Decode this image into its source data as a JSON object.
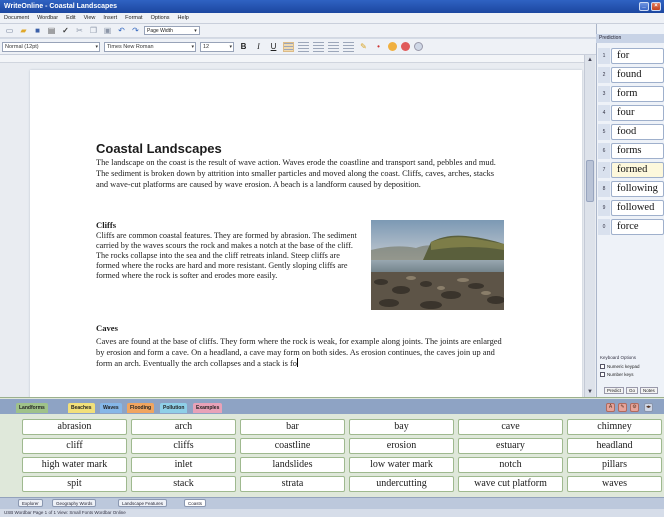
{
  "window": {
    "title": "WriteOnline - Coastal Landscapes"
  },
  "menu": [
    "Document",
    "Wordbar",
    "Edit",
    "View",
    "Insert",
    "Format",
    "Options",
    "Help"
  ],
  "toolbar": {
    "zoom": "Page Width",
    "style": "Normal (12pt)",
    "font": "Times New Roman",
    "size": "12",
    "bold": "B",
    "italic": "I",
    "underline": "U"
  },
  "document": {
    "title": "Coastal Landscapes",
    "intro": "The landscape on the coast is the result of wave action. Waves erode the coastline and transport sand, pebbles and mud. The sediment is broken down by attrition into smaller particles and moved along the coast. Cliffs, caves, arches, stacks and wave-cut platforms are caused by wave erosion. A beach is a landform caused by deposition.",
    "cliffs_heading": "Cliffs",
    "cliffs_body": "Cliffs are common coastal features. They are formed by abrasion. The sediment carried by the waves scours the rock and makes a notch at the base of the cliff. The rocks collapse into the sea and the cliff retreats inland. Steep cliffs are formed where the rocks are hard and more resistant. Gently sloping cliffs are formed where the rock is softer and erodes more easily.",
    "caves_heading": "Caves",
    "caves_body": "Caves are found at the base of cliffs. They form where the rock is weak, for example along joints. The joints are enlarged by erosion and form a cave. On a headland, a cave may form on both sides. As erosion continues, the caves join up and form an arch. Eventually the arch collapses and a stack is fo"
  },
  "prediction": {
    "header": "Prediction",
    "items": [
      {
        "num": "1",
        "word": "for"
      },
      {
        "num": "2",
        "word": "found"
      },
      {
        "num": "3",
        "word": "form"
      },
      {
        "num": "4",
        "word": "four"
      },
      {
        "num": "5",
        "word": "food"
      },
      {
        "num": "6",
        "word": "forms"
      },
      {
        "num": "7",
        "word": "formed"
      },
      {
        "num": "8",
        "word": "following"
      },
      {
        "num": "9",
        "word": "followed"
      },
      {
        "num": "0",
        "word": "force"
      }
    ],
    "keyboard_options": "Keyboard Options",
    "opt1": "Numeric keypad",
    "opt2": "Number keys",
    "buttons": [
      "Predict",
      "Go",
      "Notes"
    ]
  },
  "wordbank": {
    "tabs": [
      {
        "label": "Landforms",
        "color": "#9fc28a"
      },
      {
        "label": "Beaches",
        "color": "#f2e07a"
      },
      {
        "label": "Waves",
        "color": "#86b7e8"
      },
      {
        "label": "Flooding",
        "color": "#f0a560"
      },
      {
        "label": "Pollution",
        "color": "#8fd0e8"
      },
      {
        "label": "Examples",
        "color": "#e8a2b8"
      }
    ],
    "words": [
      [
        "abrasion",
        "arch",
        "bar",
        "bay",
        "cave",
        "chimney"
      ],
      [
        "cliff",
        "cliffs",
        "coastline",
        "erosion",
        "estuary",
        "headland"
      ],
      [
        "high water mark",
        "inlet",
        "landslides",
        "low water mark",
        "notch",
        "pillars"
      ],
      [
        "spit",
        "stack",
        "strata",
        "undercutting",
        "wave cut platform",
        "waves"
      ]
    ]
  },
  "bottom_tabs": [
    "Explorer",
    "Geography Words",
    "Landscape Features",
    "Coasts"
  ],
  "status": "USB Wordbar   Page 1 of 1   View: Small Fonts   Wordbar Online"
}
